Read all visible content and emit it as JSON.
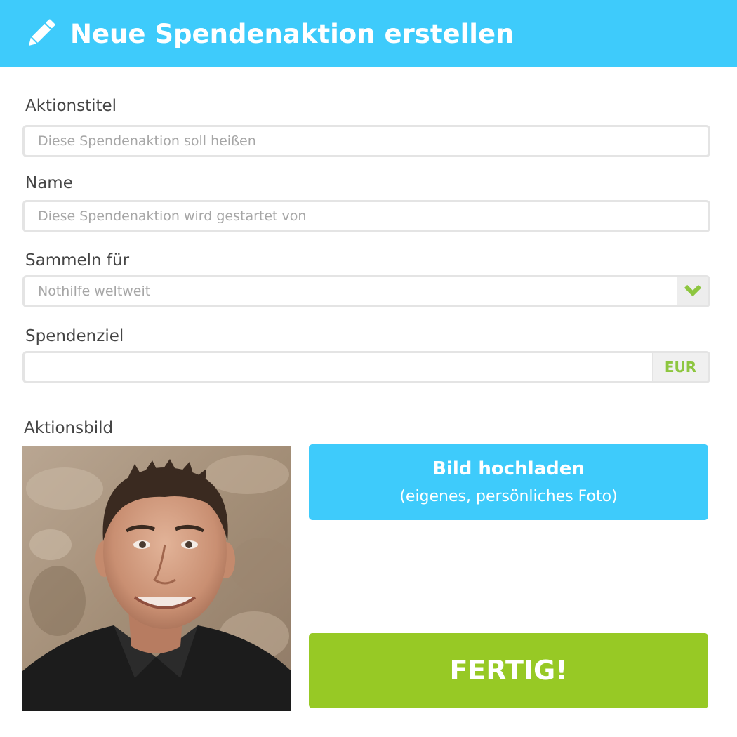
{
  "header": {
    "icon": "pencil-icon",
    "title": "Neue Spendenaktion erstellen",
    "background_color": "#3ecbfb"
  },
  "form": {
    "title_field": {
      "label": "Aktionstitel",
      "placeholder": "Diese Spendenaktion soll heißen",
      "value": ""
    },
    "name_field": {
      "label": "Name",
      "placeholder": "Diese Spendenaktion wird gestartet von",
      "value": ""
    },
    "collect_for": {
      "label": "Sammeln für",
      "selected": "Nothilfe weltweit",
      "icon": "chevron-down-icon"
    },
    "goal_field": {
      "label": "Spendenziel",
      "value": "",
      "currency": "EUR"
    },
    "image": {
      "label": "Aktionsbild",
      "upload_label": "Bild hochladen",
      "upload_sublabel": "(eigenes, persönliches Foto)"
    },
    "submit_label": "FERTIG!"
  },
  "colors": {
    "accent_blue": "#3ecbfb",
    "accent_green": "#97c925",
    "currency_green": "#8dc63f"
  }
}
